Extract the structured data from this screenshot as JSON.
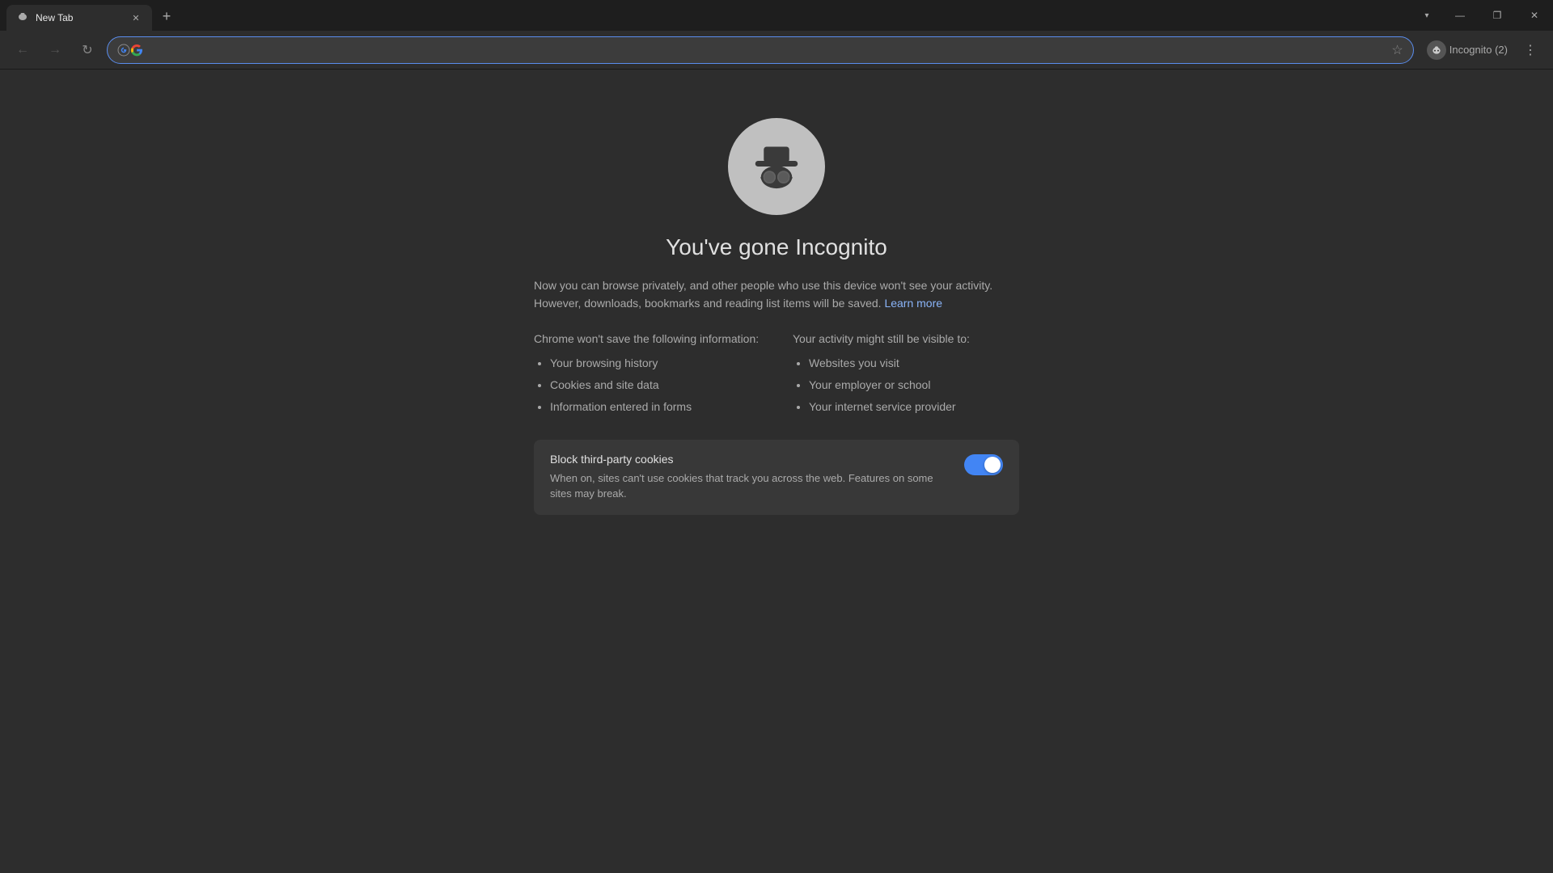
{
  "browser": {
    "tab_title": "New Tab",
    "window_controls": {
      "tab_list_label": "▾",
      "minimize_label": "—",
      "maximize_label": "❐",
      "close_label": "✕"
    },
    "toolbar": {
      "back_label": "←",
      "forward_label": "→",
      "reload_label": "↻",
      "address_value": "",
      "bookmark_label": "☆",
      "profile_label": "Incognito (2)",
      "more_label": "⋮"
    }
  },
  "page": {
    "title": "You've gone Incognito",
    "description_line1": "Now you can browse privately, and other people who use this device won't see your activity.",
    "description_line2": "However, downloads, bookmarks and reading list items will be saved.",
    "learn_more_label": "Learn more",
    "chrome_wont_save_title": "Chrome won't save the following information:",
    "chrome_wont_save_items": [
      "Your browsing history",
      "Cookies and site data",
      "Information entered in forms"
    ],
    "activity_visible_title": "Your activity might still be visible to:",
    "activity_visible_items": [
      "Websites you visit",
      "Your employer or school",
      "Your internet service provider"
    ],
    "cookie_block": {
      "title": "Block third-party cookies",
      "description": "When on, sites can't use cookies that track you across the web. Features on some sites may break.",
      "toggle_enabled": true
    }
  }
}
